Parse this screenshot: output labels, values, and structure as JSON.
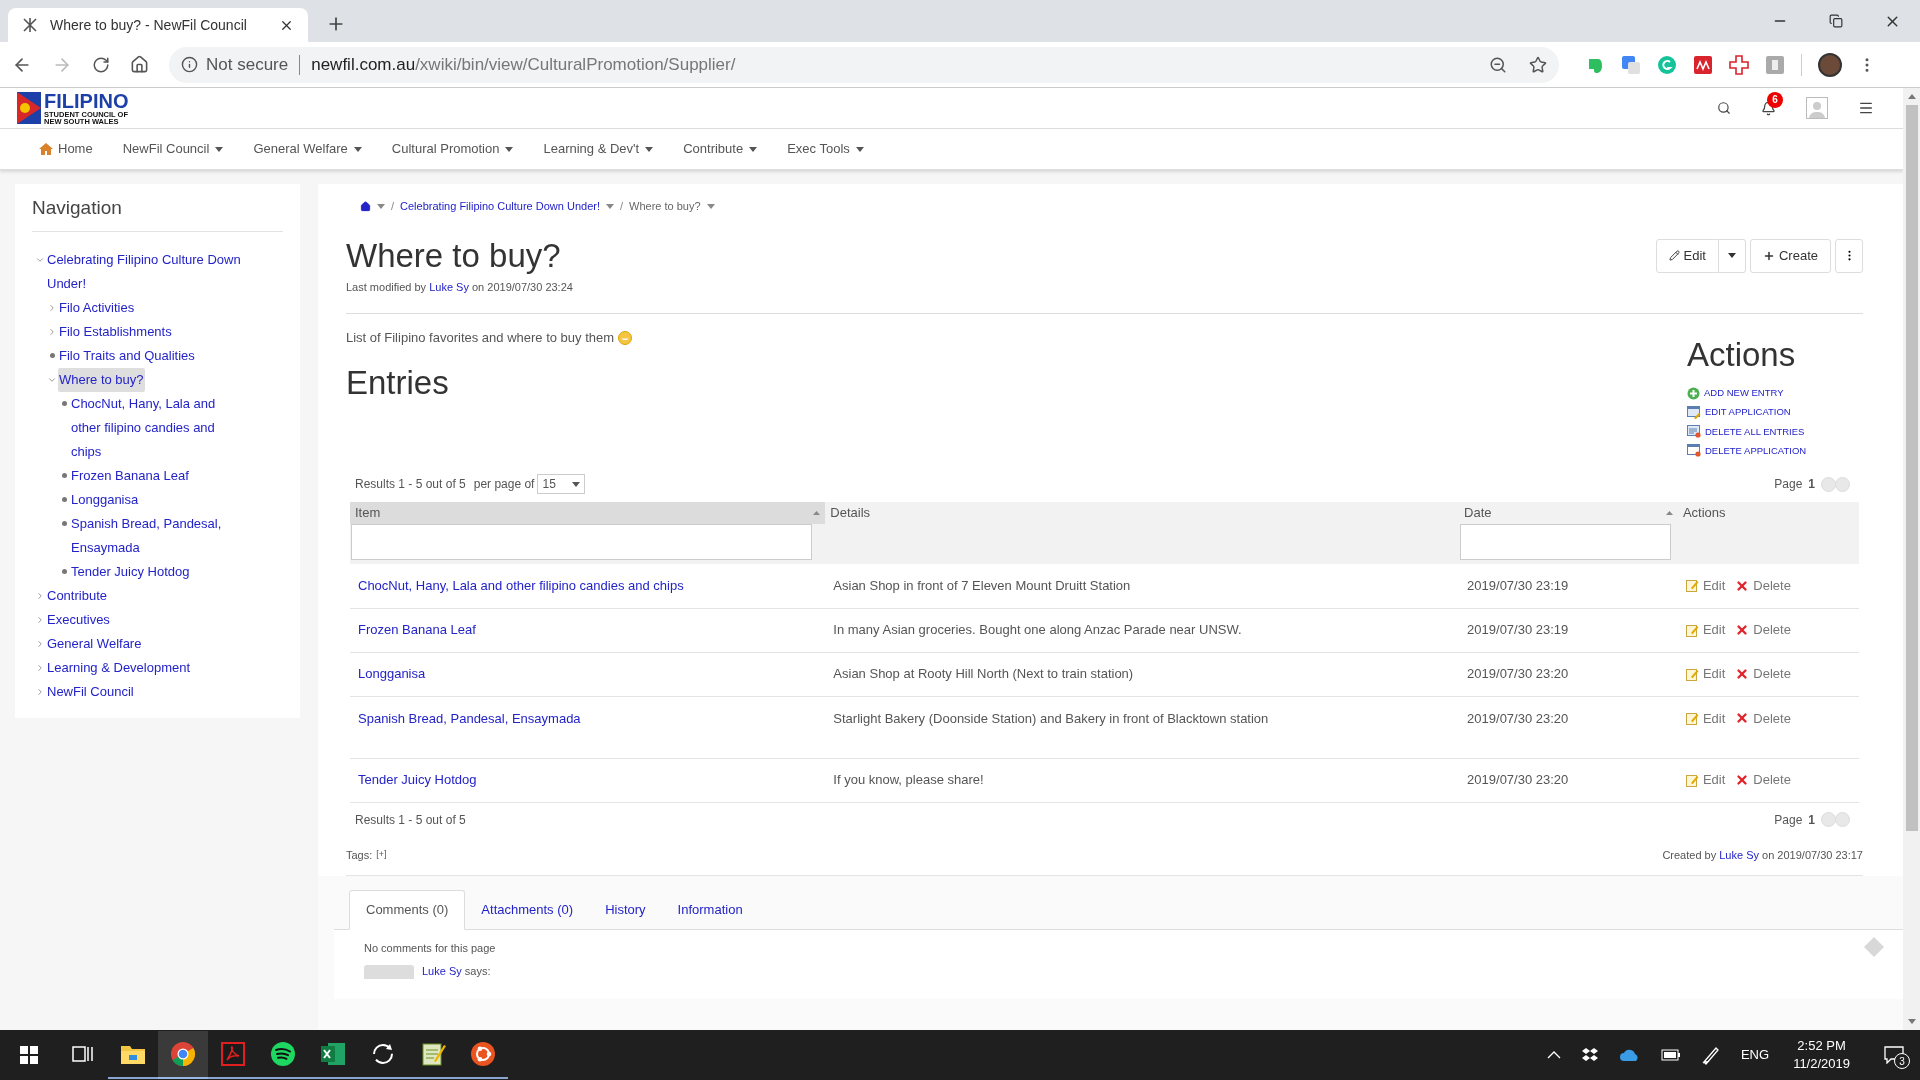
{
  "browser": {
    "tab_title": "Where to buy? - NewFil Council",
    "security": "Not secure",
    "url_host": "newfil.com.au",
    "url_path": "/xwiki/bin/view/CulturalPromotion/Supplier/"
  },
  "site": {
    "logo": [
      "FILIPINO",
      "STUDENT COUNCIL OF",
      "NEW SOUTH WALES"
    ],
    "notification_count": "6"
  },
  "menu": [
    {
      "label": "Home",
      "kind": "home"
    },
    {
      "label": "NewFil Council",
      "kind": "dropdown"
    },
    {
      "label": "General Welfare",
      "kind": "dropdown"
    },
    {
      "label": "Cultural Promotion",
      "kind": "dropdown"
    },
    {
      "label": "Learning & Dev't",
      "kind": "dropdown"
    },
    {
      "label": "Contribute",
      "kind": "dropdown"
    },
    {
      "label": "Exec Tools",
      "kind": "dropdown"
    }
  ],
  "navigation": {
    "title": "Navigation",
    "tree": [
      {
        "label": "Celebrating Filipino Culture Down Under!",
        "kind": "branch",
        "expanded": true,
        "selected": false,
        "children": [
          {
            "label": "Filo Activities",
            "kind": "branch",
            "expanded": false,
            "selected": false
          },
          {
            "label": "Filo Establishments",
            "kind": "branch",
            "expanded": false,
            "selected": false
          },
          {
            "label": "Filo Traits and Qualities",
            "kind": "leaf",
            "selected": false
          },
          {
            "label": "Where to buy?",
            "kind": "branch",
            "expanded": true,
            "selected": true,
            "children": [
              {
                "label": "ChocNut, Hany, Lala and other filipino candies and chips",
                "kind": "leaf",
                "selected": false
              },
              {
                "label": "Frozen Banana Leaf",
                "kind": "leaf",
                "selected": false
              },
              {
                "label": "Longganisa",
                "kind": "leaf",
                "selected": false
              },
              {
                "label": "Spanish Bread, Pandesal, Ensaymada",
                "kind": "leaf",
                "selected": false
              },
              {
                "label": "Tender Juicy Hotdog",
                "kind": "leaf",
                "selected": false
              }
            ]
          }
        ]
      },
      {
        "label": "Contribute",
        "kind": "branch",
        "expanded": false,
        "selected": false
      },
      {
        "label": "Executives",
        "kind": "branch",
        "expanded": false,
        "selected": false
      },
      {
        "label": "General Welfare",
        "kind": "branch",
        "expanded": false,
        "selected": false
      },
      {
        "label": "Learning & Development",
        "kind": "branch",
        "expanded": false,
        "selected": false
      },
      {
        "label": "NewFil Council",
        "kind": "branch",
        "expanded": false,
        "selected": false
      }
    ]
  },
  "breadcrumb": [
    {
      "separator": "/",
      "label": "Celebrating Filipino Culture Down Under!",
      "current": false
    },
    {
      "separator": "/",
      "label": "Where to buy?",
      "current": true
    }
  ],
  "page": {
    "title": "Where to buy?",
    "modified_prefix": "Last modified by",
    "author": "Luke Sy",
    "modified_suffix": "on 2019/07/30 23:24",
    "buttons": [
      {
        "label": "Edit",
        "kind": "edit"
      },
      {
        "label": "Create",
        "kind": "create"
      }
    ],
    "description": "List of Filipino favorites and where to buy them",
    "entries_heading": "Entries"
  },
  "actions": {
    "title": "Actions",
    "links": [
      {
        "label": "ADD NEW ENTRY",
        "kind": "add"
      },
      {
        "label": "EDIT APPLICATION",
        "kind": "edit"
      },
      {
        "label": "DELETE ALL ENTRIES",
        "kind": "delete_all"
      },
      {
        "label": "DELETE APPLICATION",
        "kind": "delete"
      }
    ]
  },
  "results": {
    "summary": "Results 1 - 5 out of 5",
    "per_page_label": "per page of",
    "per_page": "15",
    "page_label": "Page",
    "page_number": "1"
  },
  "table": {
    "columns": [
      {
        "label": "Item",
        "sorted": true,
        "sortable": true,
        "filter": true
      },
      {
        "label": "Details",
        "sorted": false,
        "sortable": false,
        "filter": false
      },
      {
        "label": "Date",
        "sorted": false,
        "sortable": true,
        "filter": true
      },
      {
        "label": "Actions",
        "sorted": false,
        "sortable": false,
        "filter": false
      }
    ],
    "rows": [
      {
        "item": "ChocNut, Hany, Lala and other filipino candies and chips",
        "details": "Asian Shop in front of 7 Eleven Mount Druitt Station",
        "date": "2019/07/30 23:19",
        "actions": [
          {
            "label": "Edit",
            "kind": "edit"
          },
          {
            "label": "Delete",
            "kind": "delete"
          }
        ]
      },
      {
        "item": "Frozen Banana Leaf",
        "details": "In many Asian groceries. Bought one along Anzac Parade near UNSW.",
        "date": "2019/07/30 23:19",
        "actions": [
          {
            "label": "Edit",
            "kind": "edit"
          },
          {
            "label": "Delete",
            "kind": "delete"
          }
        ]
      },
      {
        "item": "Longganisa",
        "details": "Asian Shop at Rooty Hill North (Next to train station)",
        "date": "2019/07/30 23:20",
        "actions": [
          {
            "label": "Edit",
            "kind": "edit"
          },
          {
            "label": "Delete",
            "kind": "delete"
          }
        ]
      },
      {
        "item": "Spanish Bread, Pandesal, Ensaymada",
        "details": "Starlight Bakery (Doonside Station) and Bakery in front of Blacktown station",
        "date": "2019/07/30 23:20",
        "actions": [
          {
            "label": "Edit",
            "kind": "edit"
          },
          {
            "label": "Delete",
            "kind": "delete"
          }
        ]
      },
      {
        "item": "Tender Juicy Hotdog",
        "details": "If you know, please share!",
        "date": "2019/07/30 23:20",
        "actions": [
          {
            "label": "Edit",
            "kind": "edit"
          },
          {
            "label": "Delete",
            "kind": "delete"
          }
        ]
      }
    ]
  },
  "footer_results": {
    "summary": "Results 1 - 5 out of 5",
    "page_label": "Page",
    "page_number": "1"
  },
  "tags": {
    "label": "Tags:",
    "add": "[+]"
  },
  "created": {
    "prefix": "Created by",
    "author": "Luke Sy",
    "suffix": "on 2019/07/30 23:17"
  },
  "tabs": [
    {
      "label": "Comments (0)",
      "selected": true
    },
    {
      "label": "Attachments (0)",
      "selected": false
    },
    {
      "label": "History",
      "selected": false
    },
    {
      "label": "Information",
      "selected": false
    }
  ],
  "comments": {
    "empty": "No comments for this page",
    "author": "Luke Sy",
    "says": "says:"
  },
  "taskbar": {
    "apps": [
      {
        "kind": "task_view",
        "selected": false
      },
      {
        "kind": "folder",
        "selected": false
      },
      {
        "kind": "browser",
        "selected": true
      },
      {
        "kind": "pdf",
        "selected": false
      },
      {
        "kind": "music",
        "selected": false
      },
      {
        "kind": "spreadsheet",
        "selected": false
      },
      {
        "kind": "sync",
        "selected": false
      },
      {
        "kind": "notepad",
        "selected": false
      },
      {
        "kind": "orange_circle",
        "selected": false
      }
    ],
    "language": "ENG",
    "time": "2:52 PM",
    "date": "11/2/2019",
    "notification_count": "3"
  }
}
